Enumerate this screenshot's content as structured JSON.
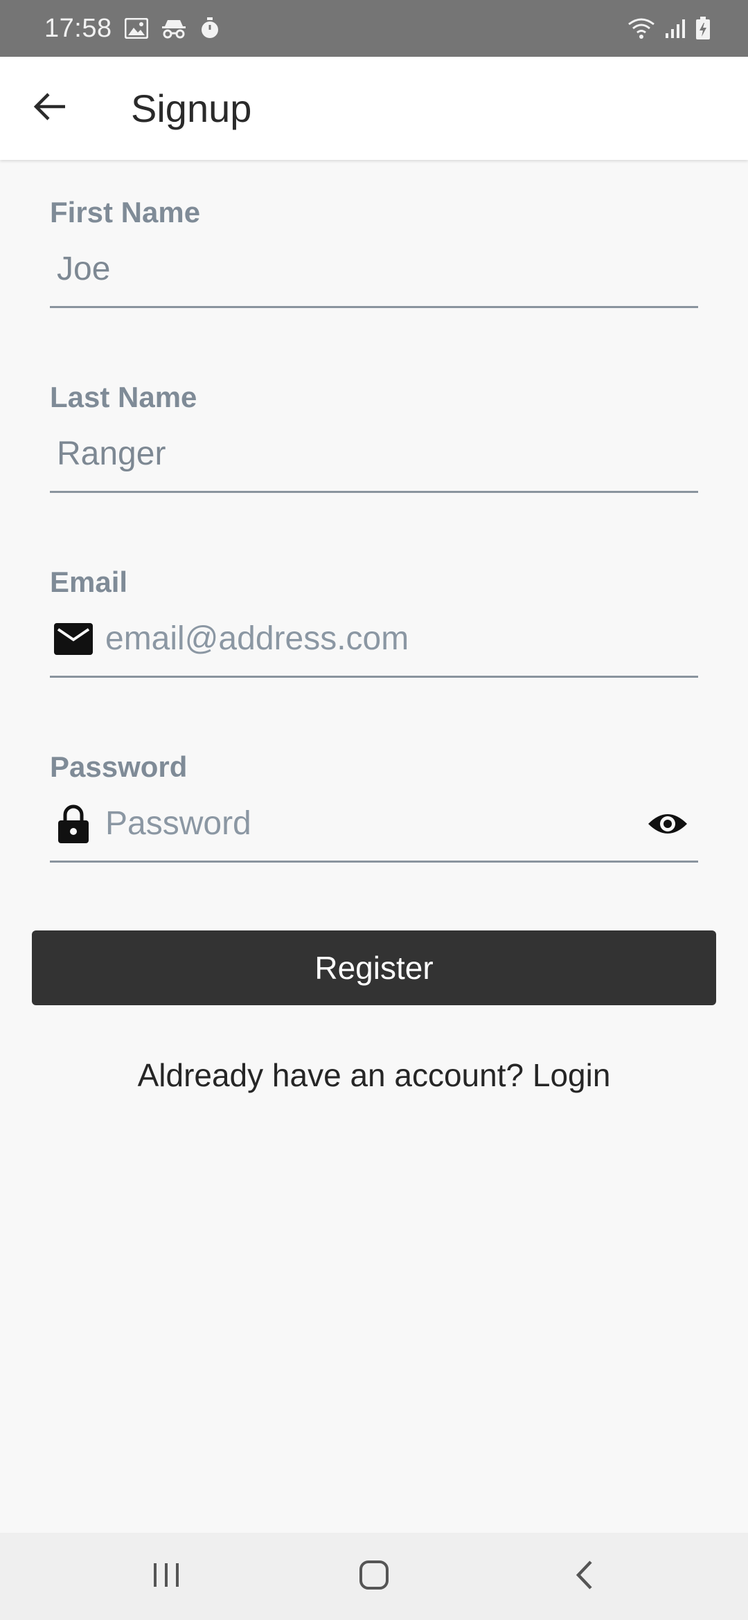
{
  "status_bar": {
    "time": "17:58",
    "left_icons": [
      "image-icon",
      "incognito-icon",
      "stopwatch-icon"
    ],
    "right_icons": [
      "wifi-icon",
      "signal-icon",
      "battery-charging-icon"
    ]
  },
  "app_bar": {
    "back_icon": "arrow-back-icon",
    "title": "Signup"
  },
  "form": {
    "first_name": {
      "label": "First Name",
      "value": "Joe"
    },
    "last_name": {
      "label": "Last Name",
      "value": "Ranger"
    },
    "email": {
      "label": "Email",
      "placeholder": "email@address.com",
      "icon": "mail-icon"
    },
    "password": {
      "label": "Password",
      "placeholder": "Password",
      "icon": "lock-icon",
      "toggle_icon": "eye-icon"
    }
  },
  "register_button": {
    "label": "Register"
  },
  "login_link": {
    "text": "Aldready have an account? Login"
  },
  "nav_bar": {
    "buttons": [
      "recents-icon",
      "home-icon",
      "back-icon"
    ]
  },
  "colors": {
    "status_bar_bg": "#757575",
    "app_bar_bg": "#ffffff",
    "page_bg": "#f8f8f8",
    "label": "#7f8b97",
    "button_bg": "#333333",
    "button_text": "#ffffff",
    "nav_bg": "#efefef"
  }
}
